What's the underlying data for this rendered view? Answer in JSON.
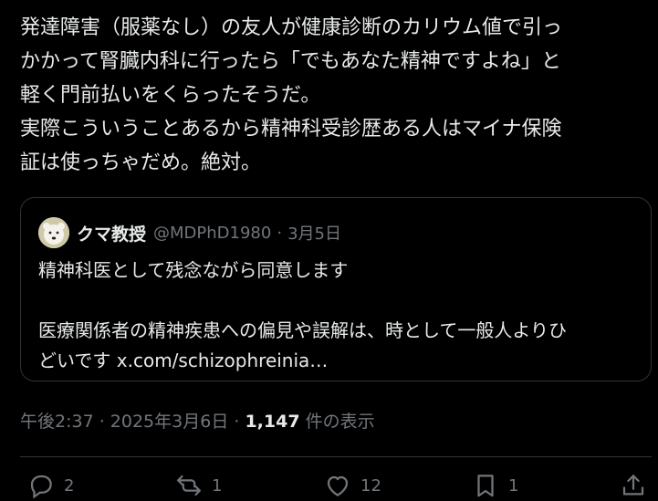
{
  "post": {
    "lines": [
      "発達障害（服薬なし）の友人が健康診断のカリウム値で引っ",
      "かかって腎臓内科に行ったら「でもあなた精神ですよね」と",
      "軽く門前払いをくらったそうだ。",
      "実際こういうことあるから精神科受診歴ある人はマイナ保険",
      "証は使っちゃだめ。絶対。"
    ]
  },
  "quote": {
    "display_name": "クマ教授",
    "handle": "@MDPhD1980",
    "separator": "·",
    "date": "3月5日",
    "body_line1": "精神科医として残念ながら同意します",
    "body_line2": "医療関係者の精神疾患への偏見や誤解は、時として一般人よりひ",
    "body_line3_prefix": "どいです ",
    "body_link": "x.com/schizophreinia…"
  },
  "meta": {
    "time": "午後2:37",
    "sep1": " · ",
    "date": "2025年3月6日",
    "sep2": " · ",
    "views_count": "1,147",
    "views_label": " 件の表示"
  },
  "actions": {
    "reply_count": "2",
    "repost_count": "1",
    "like_count": "12",
    "bookmark_count": "1"
  },
  "icons": [
    "reply-icon",
    "repost-icon",
    "like-icon",
    "bookmark-icon",
    "share-icon"
  ],
  "colors": {
    "background": "#000000",
    "text": "#e7e9ea",
    "muted": "#71767b",
    "border": "#2f3336"
  }
}
